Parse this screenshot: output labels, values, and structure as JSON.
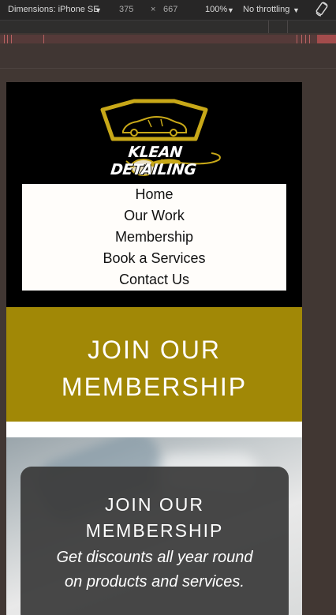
{
  "devtools": {
    "dimensions_label": "Dimensions: iPhone SE",
    "width": "375",
    "times": "×",
    "height": "667",
    "zoom": "100%",
    "throttling": "No throttling",
    "caret": "▼"
  },
  "site": {
    "logo_text": "KLEAN DETAILING",
    "nav": [
      {
        "label": "Home"
      },
      {
        "label": "Our Work"
      },
      {
        "label": "Membership"
      },
      {
        "label": "Book a Services"
      },
      {
        "label": "Contact Us"
      }
    ],
    "banner": {
      "line1": "JOIN OUR",
      "line2": "MEMBERSHIP"
    },
    "hero": {
      "title_line1": "JOIN OUR",
      "title_line2": "MEMBERSHIP",
      "subtitle_line1": "Get discounts all year round",
      "subtitle_line2": "on products and services."
    }
  },
  "colors": {
    "brand_gold": "#a18806",
    "header_bg": "#000000",
    "nav_bg": "#fffdfa",
    "devtools_bg": "#272626"
  }
}
